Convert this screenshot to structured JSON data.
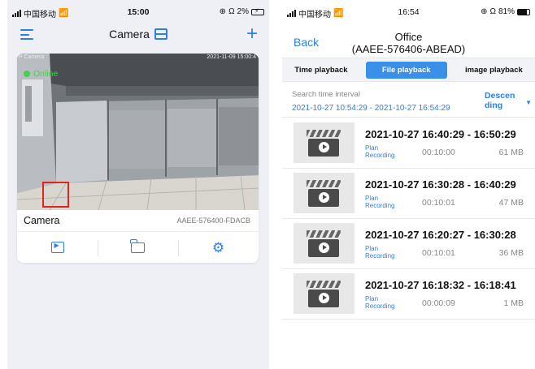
{
  "left_phone": {
    "status": {
      "carrier": "中国移动",
      "time": "15:00",
      "battery": "2%"
    },
    "nav": {
      "title": "Camera",
      "menu_icon": "menu-icon",
      "list_icon": "list-view-icon",
      "add_icon": "plus-icon"
    },
    "camera": {
      "overlay_tag": "P Camera",
      "overlay_time": "2021-11-09 15:00:4",
      "status": "Online",
      "name": "Camera",
      "device_id": "AAEE-576400-FDACB"
    },
    "actions": [
      {
        "icon": "playback-icon"
      },
      {
        "icon": "folder-icon"
      },
      {
        "icon": "settings-gear-icon"
      }
    ],
    "colors": {
      "accent": "#2d7ee6",
      "online": "#3fd24b",
      "highlight": "#e0241e"
    }
  },
  "right_phone": {
    "status": {
      "carrier": "中国移动",
      "time": "16:54",
      "battery": "81%"
    },
    "nav": {
      "back": "Back",
      "title_line1": "Office",
      "title_line2": "(AAEE-576406-ABEAD)"
    },
    "tabs": [
      {
        "label": "Time playback",
        "active": false
      },
      {
        "label": "File playback",
        "active": true
      },
      {
        "label": "image playback",
        "active": false
      }
    ],
    "search": {
      "label": "Search time interval",
      "range": "2021-10-27 10:54:29 - 2021-10-27 16:54:29",
      "sort_label": "Descen ding"
    },
    "recordings": [
      {
        "time": "2021-10-27  16:40:29 - 16:50:29",
        "type": "Plan Recording",
        "duration": "00:10:00",
        "size": "61 MB"
      },
      {
        "time": "2021-10-27  16:30:28 - 16:40:29",
        "type": "Plan Recording",
        "duration": "00:10:01",
        "size": "47 MB"
      },
      {
        "time": "2021-10-27  16:20:27 - 16:30:28",
        "type": "Plan Recording",
        "duration": "00:10:01",
        "size": "36 MB"
      },
      {
        "time": "2021-10-27  16:18:32 - 16:18:41",
        "type": "Plan Recording",
        "duration": "00:00:09",
        "size": "1 MB"
      }
    ],
    "colors": {
      "accent": "#2d7ee6",
      "active_tab": "#3a8fe9"
    }
  }
}
